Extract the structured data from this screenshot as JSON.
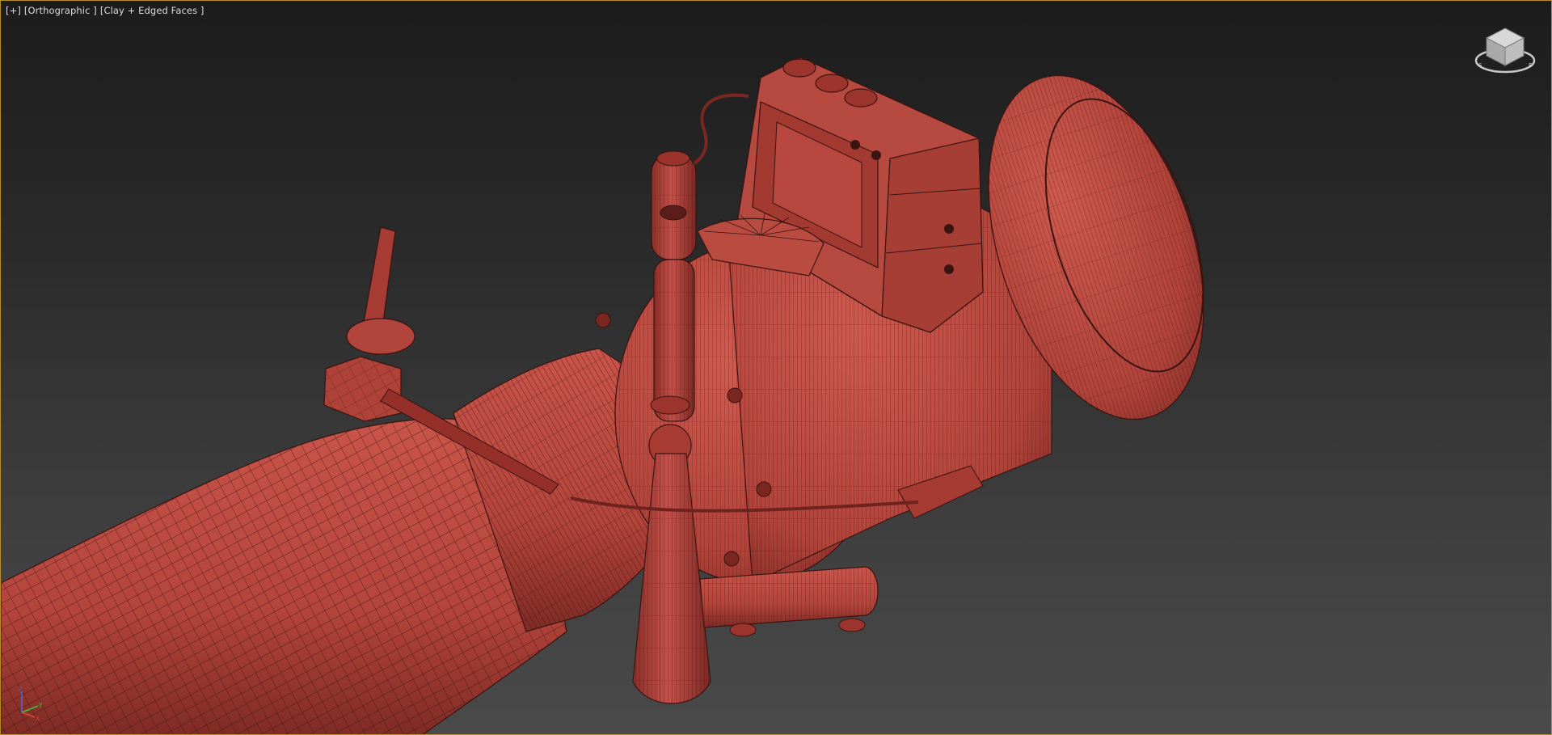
{
  "viewport": {
    "labels": [
      "[+]",
      "[Orthographic ]",
      "[Clay + Edged Faces ]"
    ],
    "border_color": "#b58e2a",
    "background_top": "#1c1c1c",
    "background_bottom": "#4a4a4a",
    "active": true
  },
  "model": {
    "material_color": "#b8453d",
    "wire_color": "#3a1411",
    "shading_mode": "Clay + Edged Faces"
  },
  "viewcube": {
    "icon": "viewcube-icon"
  },
  "axis_tripod": {
    "icon": "axis-tripod-icon",
    "axes": [
      "z",
      "y",
      "x"
    ],
    "colors": {
      "x": "#d84a3a",
      "y": "#3ec23e",
      "z": "#4a6ed8"
    }
  }
}
